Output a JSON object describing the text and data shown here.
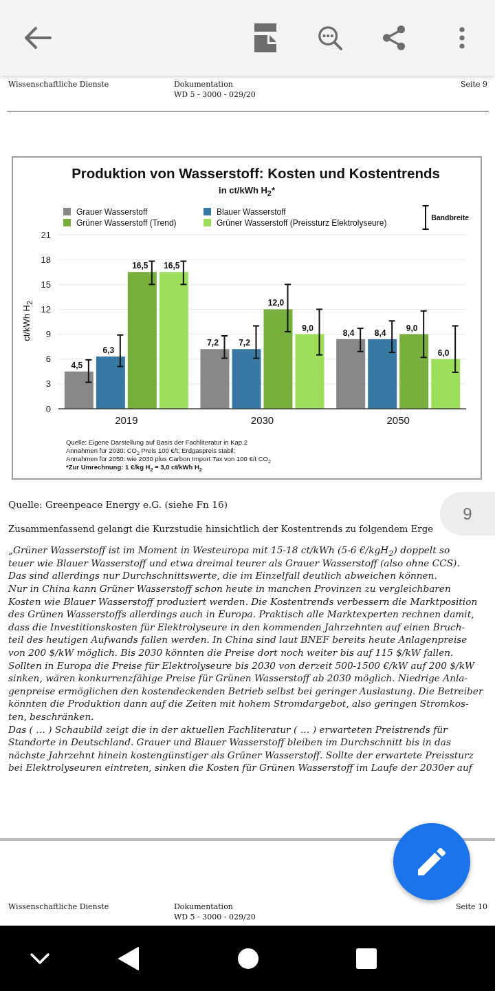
{
  "pages": [
    {
      "header": {
        "left": "Wissenschaftliche Dienste",
        "center": [
          "Dokumentation",
          "WD 5 - 3000 - 029/20"
        ],
        "right": "Seite 9"
      },
      "figure": {
        "subtitle": "in ct/kWh H$_{2}$*",
        "error_bar_legend": "Bandbreite",
        "chart_data": {
          "type": "bar",
          "title": "Produktion von Wasserstoff: Kosten und Kostentrends",
          "ylabel": "ct/kWh H$_{2}$",
          "categories": [
            "2019",
            "2030",
            "2050"
          ],
          "series": [
            {
              "name": "Grauer Wasserstoff",
              "color": "#878787",
              "values": [
                4.5,
                7.2,
                8.4
              ],
              "value_labels": [
                "4,5",
                "7,2",
                "8,4"
              ],
              "errors": [
                [
                  3.2,
                  5.9
                ],
                [
                  6.1,
                  8.8
                ],
                [
                  6.9,
                  9.7
                ]
              ]
            },
            {
              "name": "Blauer Wasserstoff",
              "color": "#3879a4",
              "values": [
                6.3,
                7.2,
                8.4
              ],
              "value_labels": [
                "6,3",
                "7,2",
                "8,4"
              ],
              "errors": [
                [
                  5.1,
                  8.9
                ],
                [
                  6.1,
                  10.0
                ],
                [
                  6.8,
                  10.6
                ]
              ]
            },
            {
              "name": "Grüner Wasserstoff (Trend)",
              "color": "#77ae3e",
              "values": [
                16.5,
                12.0,
                9.0
              ],
              "value_labels": [
                "16,5",
                "12,0",
                "9,0"
              ],
              "errors": [
                [
                  15.0,
                  17.8
                ],
                [
                  9.3,
                  15.0
                ],
                [
                  6.2,
                  11.8
                ]
              ]
            },
            {
              "name": "Grüner Wasserstoff (Preissturz Elektrolyseure)",
              "color": "#9ddf5b",
              "values": [
                16.5,
                9.0,
                6.0
              ],
              "value_labels": [
                "16,5",
                "9,0",
                "6,0"
              ],
              "errors": [
                [
                  15.0,
                  17.8
                ],
                [
                  6.5,
                  12.0
                ],
                [
                  4.4,
                  10.0
                ]
              ]
            }
          ],
          "ylim": [
            0,
            21
          ],
          "yticks": [
            0,
            3,
            6,
            9,
            12,
            15,
            18,
            21
          ],
          "data_labels": true,
          "grid": true,
          "legend": "top"
        },
        "notes": [
          {
            "text": "Quelle: Eigene Darstellung auf Basis der Fachliteratur in Kap.2",
            "bold": false
          },
          {
            "text": "Annahmen für 2030: CO$_{2}$ Preis 100 €/t; Erdgaspreis stabil;",
            "bold": false
          },
          {
            "text": "Annahmen für 2050: wie 2030 plus Carbon Import Tax von 100 €/t CO$_{2}$",
            "bold": false
          },
          {
            "text": "*Zur Umrechnung: 1 €/kg H$_{2}$ = 3,0 ct/kWh H$_{2}$",
            "bold": true
          }
        ]
      },
      "source": "Quelle: Greenpeace Energy e.G. (siehe Fn 16)",
      "intro": "Zusammenfassend gelangt die Kurzstudie hinsichtlich der Kostentrends zu folgendem Erge",
      "quote": [
        {
          "lines": [
            "„Grüner Wasserstoff ist im Moment in Westeuropa mit 15-18 ct/kWh (5-6 €/kgH$_{2}$) doppelt so",
            "teuer wie Blauer Wasserstoff und etwa dreimal teurer als Grauer Wasserstoff (also ohne CCS).",
            "Das sind allerdings nur Durchschnittswerte, die im Einzelfall deutlich abweichen können."
          ]
        },
        {
          "lines": [
            "Nur in China kann Grüner Wasserstoff schon heute in manchen Provinzen zu vergleichbaren",
            "Kosten wie Blauer Wasserstoff produziert werden. Die Kostentrends verbessern die Marktposition",
            "des Grünen Wasserstoffs allerdings auch in Europa. Praktisch alle Marktexperten rechnen damit,",
            "dass die Investitionskosten für Elektrolyseure in den kommenden Jahrzehnten auf einen Bruch-",
            "teil des heutigen Aufwands fallen werden. In China sind laut BNEF bereits heute Anlagenpreise",
            "von 200 $/kW möglich. Bis 2030 könnten die Preise dort noch weiter bis auf 115 $/kW fallen.",
            "Sollten in Europa die Preise für Elektrolyseure bis 2030 von derzeit 500-1500 €/kW auf 200 $/kW",
            "sinken, wären konkurrenzfähige Preise für Grünen Wasserstoff ab 2030 möglich. Niedrige Anla-",
            "genpreise ermöglichen den kostendeckenden Betrieb selbst bei geringer Auslastung. Die Betreiber",
            "könnten die Produktion dann auf die Zeiten mit hohem Stromdargebot, also geringen Stromkos-",
            "ten, beschränken."
          ]
        },
        {
          "lines": [
            "Das ( … ) Schaubild zeigt die in der aktuellen Fachliteratur ( … ) erwarteten Preistrends für",
            "Standorte in Deutschland. Grauer und Blauer Wasserstoff bleiben im Durchschnitt bis in das",
            "nächste Jahrzehnt hinein kostengünstiger als Grüner Wasserstoff. Sollte der erwartete Preissturz",
            "bei Elektrolyseuren eintreten, sinken die Kosten für Grünen Wasserstoff im Laufe der 2030er auf"
          ]
        }
      ]
    },
    {
      "header": {
        "left": "Wissenschaftliche Dienste",
        "center": [
          "Dokumentation",
          "WD 5 - 3000 - 029/20"
        ],
        "right": "Seite 10"
      }
    }
  ],
  "page_indicator": "9"
}
